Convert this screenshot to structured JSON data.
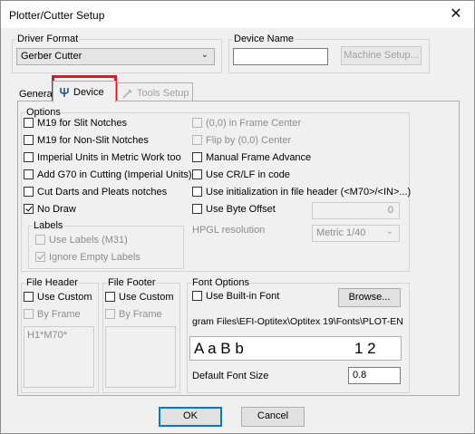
{
  "window": {
    "title": "Plotter/Cutter Setup",
    "close_glyph": "✕"
  },
  "driver_format": {
    "legend": "Driver Format",
    "selected": "Gerber Cutter"
  },
  "device_name": {
    "legend": "Device Name",
    "value": "",
    "machine_setup_label": "Machine Setup..."
  },
  "tabs": [
    {
      "label": "General"
    },
    {
      "label": "Device",
      "icon": "device-fork-icon",
      "active": true
    },
    {
      "label": "Tools Setup",
      "icon": "tools-icon",
      "disabled": true
    }
  ],
  "options": {
    "legend": "Options",
    "left": [
      {
        "label": "M19 for Slit Notches",
        "checked": false,
        "disabled": false
      },
      {
        "label": "M19 for Non-Slit Notches",
        "checked": false,
        "disabled": false
      },
      {
        "label": "Imperial Units in Metric Work too",
        "checked": false,
        "disabled": false
      },
      {
        "label": "Add G70 in Cutting (Imperial Units)",
        "checked": false,
        "disabled": false
      },
      {
        "label": "Cut Darts and Pleats notches",
        "checked": false,
        "disabled": false
      },
      {
        "label": "No Draw",
        "checked": true,
        "disabled": false
      }
    ],
    "right": [
      {
        "label": "(0,0) in Frame Center",
        "checked": false,
        "disabled": true
      },
      {
        "label": "Flip by (0,0) Center",
        "checked": false,
        "disabled": true
      },
      {
        "label": "Manual Frame Advance",
        "checked": false,
        "disabled": false
      },
      {
        "label": "Use CR/LF in code",
        "checked": false,
        "disabled": false
      },
      {
        "label": "Use initialization in file header (<M70>/<IN>...)",
        "checked": false,
        "disabled": false
      },
      {
        "label": "Use Byte Offset",
        "checked": false,
        "disabled": false
      }
    ],
    "byte_offset_value": "0",
    "labels": {
      "legend": "Labels",
      "use_labels": "Use Labels (M31)",
      "ignore_empty": "Ignore Empty Labels"
    },
    "hpgl": {
      "label": "HPGL resolution",
      "selected": "Metric 1/40"
    }
  },
  "file_header": {
    "legend": "File Header",
    "use_custom": "Use Custom",
    "by_frame": "By Frame",
    "text": "H1*M70*"
  },
  "file_footer": {
    "legend": "File Footer",
    "use_custom": "Use Custom",
    "by_frame": "By Frame"
  },
  "font_options": {
    "legend": "Font Options",
    "use_builtin": "Use Built-in Font",
    "browse_label": "Browse...",
    "path": "gram Files\\EFI-Optitex\\Optitex 19\\Fonts\\PLOT-EN",
    "sample_letters": "A  a  B  b",
    "sample_digits": "1   2",
    "default_font_size_label": "Default Font Size",
    "default_font_size": "0.8"
  },
  "buttons": {
    "ok": "OK",
    "cancel": "Cancel"
  }
}
